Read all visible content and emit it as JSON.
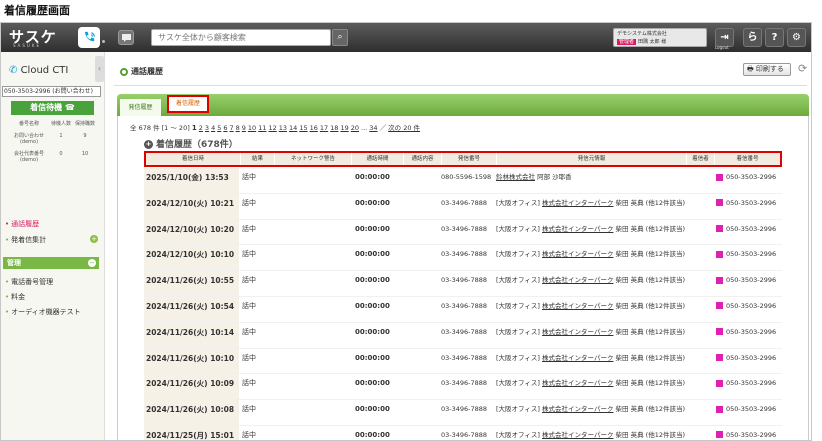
{
  "caption": "着信履歴画面",
  "topbar": {
    "logo": "サスケ",
    "logo_sub": "SASUKE",
    "search_placeholder": "サスケ全体から顧客検索",
    "company": "デモシステム株式会社",
    "badge": "管理者",
    "user": "田隅 太郎 様",
    "logout": "Logout",
    "icons": [
      "logout-icon",
      "sasuke-icon",
      "help-icon",
      "gear-icon"
    ]
  },
  "sidebar": {
    "title": "Cloud CTI",
    "select_value": "050-3503-2996 (お問い合わせ)",
    "wait_label": "着信待機",
    "status_headers": [
      "番号名称",
      "待機人数",
      "保持職数"
    ],
    "status_rows": [
      [
        "お問い合わせ(demo)",
        "1",
        "9"
      ],
      [
        "会社代表番号(demo)",
        "0",
        "10"
      ]
    ],
    "links": [
      "通話履歴",
      "発着信集計"
    ],
    "mgmt_title": "管理",
    "mgmt_links": [
      "電話番号管理",
      "料金",
      "オーディオ機器テスト"
    ]
  },
  "main": {
    "breadcrumb": "通話履歴",
    "print_label": "印刷する",
    "tabs": [
      "発信履歴",
      "着信履歴"
    ],
    "pager": {
      "total": "全 678 件",
      "range": "[1 〜 20]",
      "current": "1",
      "pages": [
        "2",
        "3",
        "4",
        "5",
        "6",
        "7",
        "8",
        "9",
        "10",
        "11",
        "12",
        "13",
        "14",
        "15",
        "16",
        "17",
        "18",
        "19",
        "20"
      ],
      "ellipsis": "...",
      "last": "34",
      "sep": "／",
      "next": "次の 20 件"
    },
    "section_title": "着信履歴（678件）",
    "columns": [
      "着信日時",
      "結果",
      "ネットワーク警告",
      "通話時間",
      "通話内容",
      "発信番号",
      "発信元情報",
      "着信者",
      "着信番号"
    ],
    "rows": [
      {
        "datetime": "2025/1/10(金) 13:53",
        "result": "話中",
        "duration": "00:00:00",
        "from": "080-5596-1598",
        "info_prefix": "",
        "info_link": "鈴林株式会社",
        "info_suffix": " 阿部 沙耶香",
        "to": "050-3503-2996"
      },
      {
        "datetime": "2024/12/10(火) 10:21",
        "result": "話中",
        "duration": "00:00:00",
        "from": "03-3496-7888",
        "info_prefix": "[大阪オフィス] ",
        "info_link": "株式会社インターパーク",
        "info_suffix": " 柴田 英典 (他12件該当)",
        "to": "050-3503-2996"
      },
      {
        "datetime": "2024/12/10(火) 10:20",
        "result": "話中",
        "duration": "00:00:00",
        "from": "03-3496-7888",
        "info_prefix": "[大阪オフィス] ",
        "info_link": "株式会社インターパーク",
        "info_suffix": " 柴田 英典 (他12件該当)",
        "to": "050-3503-2996"
      },
      {
        "datetime": "2024/12/10(火) 10:10",
        "result": "話中",
        "duration": "00:00:00",
        "from": "03-3496-7888",
        "info_prefix": "[大阪オフィス] ",
        "info_link": "株式会社インターパーク",
        "info_suffix": " 柴田 英典 (他12件該当)",
        "to": "050-3503-2996"
      },
      {
        "datetime": "2024/11/26(火) 10:55",
        "result": "話中",
        "duration": "00:00:00",
        "from": "03-3496-7888",
        "info_prefix": "[大阪オフィス] ",
        "info_link": "株式会社インターパーク",
        "info_suffix": " 柴田 英典 (他12件該当)",
        "to": "050-3503-2996"
      },
      {
        "datetime": "2024/11/26(火) 10:54",
        "result": "話中",
        "duration": "00:00:00",
        "from": "03-3496-7888",
        "info_prefix": "[大阪オフィス] ",
        "info_link": "株式会社インターパーク",
        "info_suffix": " 柴田 英典 (他12件該当)",
        "to": "050-3503-2996"
      },
      {
        "datetime": "2024/11/26(火) 10:14",
        "result": "話中",
        "duration": "00:00:00",
        "from": "03-3496-7888",
        "info_prefix": "[大阪オフィス] ",
        "info_link": "株式会社インターパーク",
        "info_suffix": " 柴田 英典 (他12件該当)",
        "to": "050-3503-2996"
      },
      {
        "datetime": "2024/11/26(火) 10:10",
        "result": "話中",
        "duration": "00:00:00",
        "from": "03-3496-7888",
        "info_prefix": "[大阪オフィス] ",
        "info_link": "株式会社インターパーク",
        "info_suffix": " 柴田 英典 (他12件該当)",
        "to": "050-3503-2996"
      },
      {
        "datetime": "2024/11/26(火) 10:09",
        "result": "話中",
        "duration": "00:00:00",
        "from": "03-3496-7888",
        "info_prefix": "[大阪オフィス] ",
        "info_link": "株式会社インターパーク",
        "info_suffix": " 柴田 英典 (他12件該当)",
        "to": "050-3503-2996"
      },
      {
        "datetime": "2024/11/26(火) 10:08",
        "result": "話中",
        "duration": "00:00:00",
        "from": "03-3496-7888",
        "info_prefix": "[大阪オフィス] ",
        "info_link": "株式会社インターパーク",
        "info_suffix": " 柴田 英典 (他12件該当)",
        "to": "050-3503-2996"
      },
      {
        "datetime": "2024/11/25(月) 15:01",
        "result": "話中",
        "duration": "00:00:00",
        "from": "03-3496-7888",
        "info_prefix": "[大阪オフィス] ",
        "info_link": "株式会社インターパーク",
        "info_suffix": " 柴田 英典 (他12件該当)",
        "to": "050-3503-2996"
      }
    ]
  },
  "colors": {
    "accent": "#7ab846",
    "highlight": "#e00000",
    "marker": "#e020b0"
  }
}
